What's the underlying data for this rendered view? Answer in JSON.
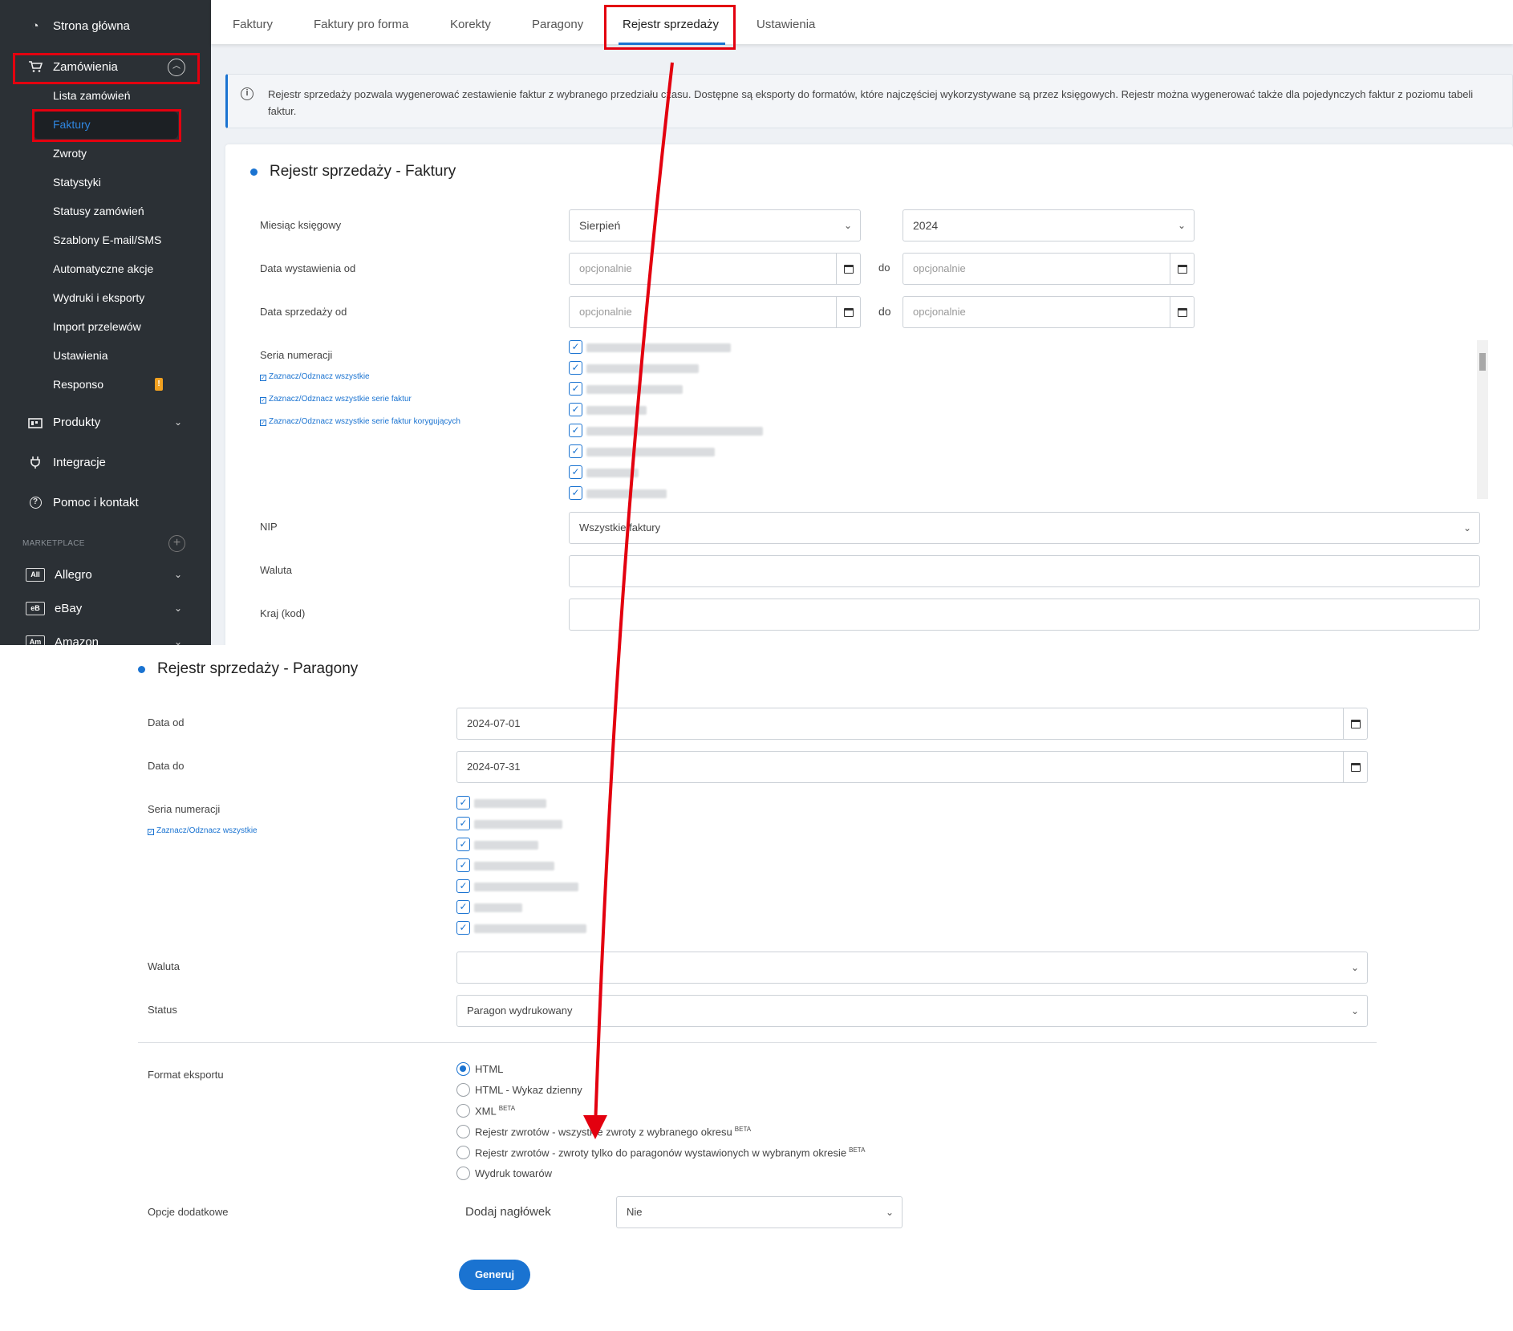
{
  "sidebar": {
    "home": "Strona główna",
    "orders": "Zamówienia",
    "order_items": [
      "Lista zamówień",
      "Faktury",
      "Zwroty",
      "Statystyki",
      "Statusy zamówień",
      "Szablony E-mail/SMS",
      "Automatyczne akcje",
      "Wydruki i eksporty",
      "Import przelewów",
      "Ustawienia",
      "Responso"
    ],
    "responso_badge": "!",
    "products": "Produkty",
    "integrations": "Integracje",
    "help": "Pomoc i kontakt",
    "marketplace_header": "MARKETPLACE",
    "marketplaces": [
      {
        "icon": "All",
        "label": "Allegro"
      },
      {
        "icon": "eB",
        "label": "eBay"
      },
      {
        "icon": "Am",
        "label": "Amazon"
      }
    ]
  },
  "tabs": [
    "Faktury",
    "Faktury pro forma",
    "Korekty",
    "Paragony",
    "Rejestr sprzedaży",
    "Ustawienia"
  ],
  "info_text": "Rejestr sprzedaży pozwala wygenerować zestawienie faktur z wybranego przedziału czasu. Dostępne są eksporty do formatów, które najczęściej wykorzystywane są przez księgowych. Rejestr można wygenerować także dla pojedynczych faktur z poziomu tabeli faktur.",
  "invoices": {
    "title": "Rejestr sprzedaży - Faktury",
    "month_label": "Miesiąc księgowy",
    "month_value": "Sierpień",
    "year_value": "2024",
    "issue_date_label": "Data wystawienia od",
    "sale_date_label": "Data sprzedaży od",
    "to_label": "do",
    "optional_placeholder": "opcjonalnie",
    "series_label": "Seria numeracji",
    "select_all": "Zaznacz/Odznacz wszystkie",
    "select_all_invoice": "Zaznacz/Odznacz wszystkie serie faktur",
    "select_all_correction": "Zaznacz/Odznacz wszystkie serie faktur korygujących",
    "nip_label": "NIP",
    "nip_value": "Wszystkie faktury",
    "currency_label": "Waluta",
    "country_label": "Kraj (kod)"
  },
  "receipts": {
    "title": "Rejestr sprzedaży - Paragony",
    "date_from_label": "Data od",
    "date_from_value": "2024-07-01",
    "date_to_label": "Data do",
    "date_to_value": "2024-07-31",
    "series_label": "Seria numeracji",
    "select_all": "Zaznacz/Odznacz wszystkie",
    "currency_label": "Waluta",
    "currency_value": "",
    "status_label": "Status",
    "status_value": "Paragon wydrukowany",
    "export_format_label": "Format eksportu",
    "formats": [
      {
        "label": "HTML",
        "beta": "",
        "selected": true
      },
      {
        "label": "HTML - Wykaz dzienny",
        "beta": "",
        "selected": false
      },
      {
        "label": "XML",
        "beta": "BETA",
        "selected": false
      },
      {
        "label": "Rejestr zwrotów - wszystkie zwroty z wybranego okresu",
        "beta": "BETA",
        "selected": false
      },
      {
        "label": "Rejestr zwrotów - zwroty tylko do paragonów wystawionych w wybranym okresie",
        "beta": "BETA",
        "selected": false
      },
      {
        "label": "Wydruk towarów",
        "beta": "",
        "selected": false
      }
    ],
    "extra_options_label": "Opcje dodatkowe",
    "add_header_label": "Dodaj nagłówek",
    "add_header_value": "Nie",
    "generate_button": "Generuj"
  },
  "colors": {
    "accent": "#1a73d1",
    "sidebar": "#2b3035",
    "highlight": "#e3000f",
    "badge": "#f0a020"
  }
}
